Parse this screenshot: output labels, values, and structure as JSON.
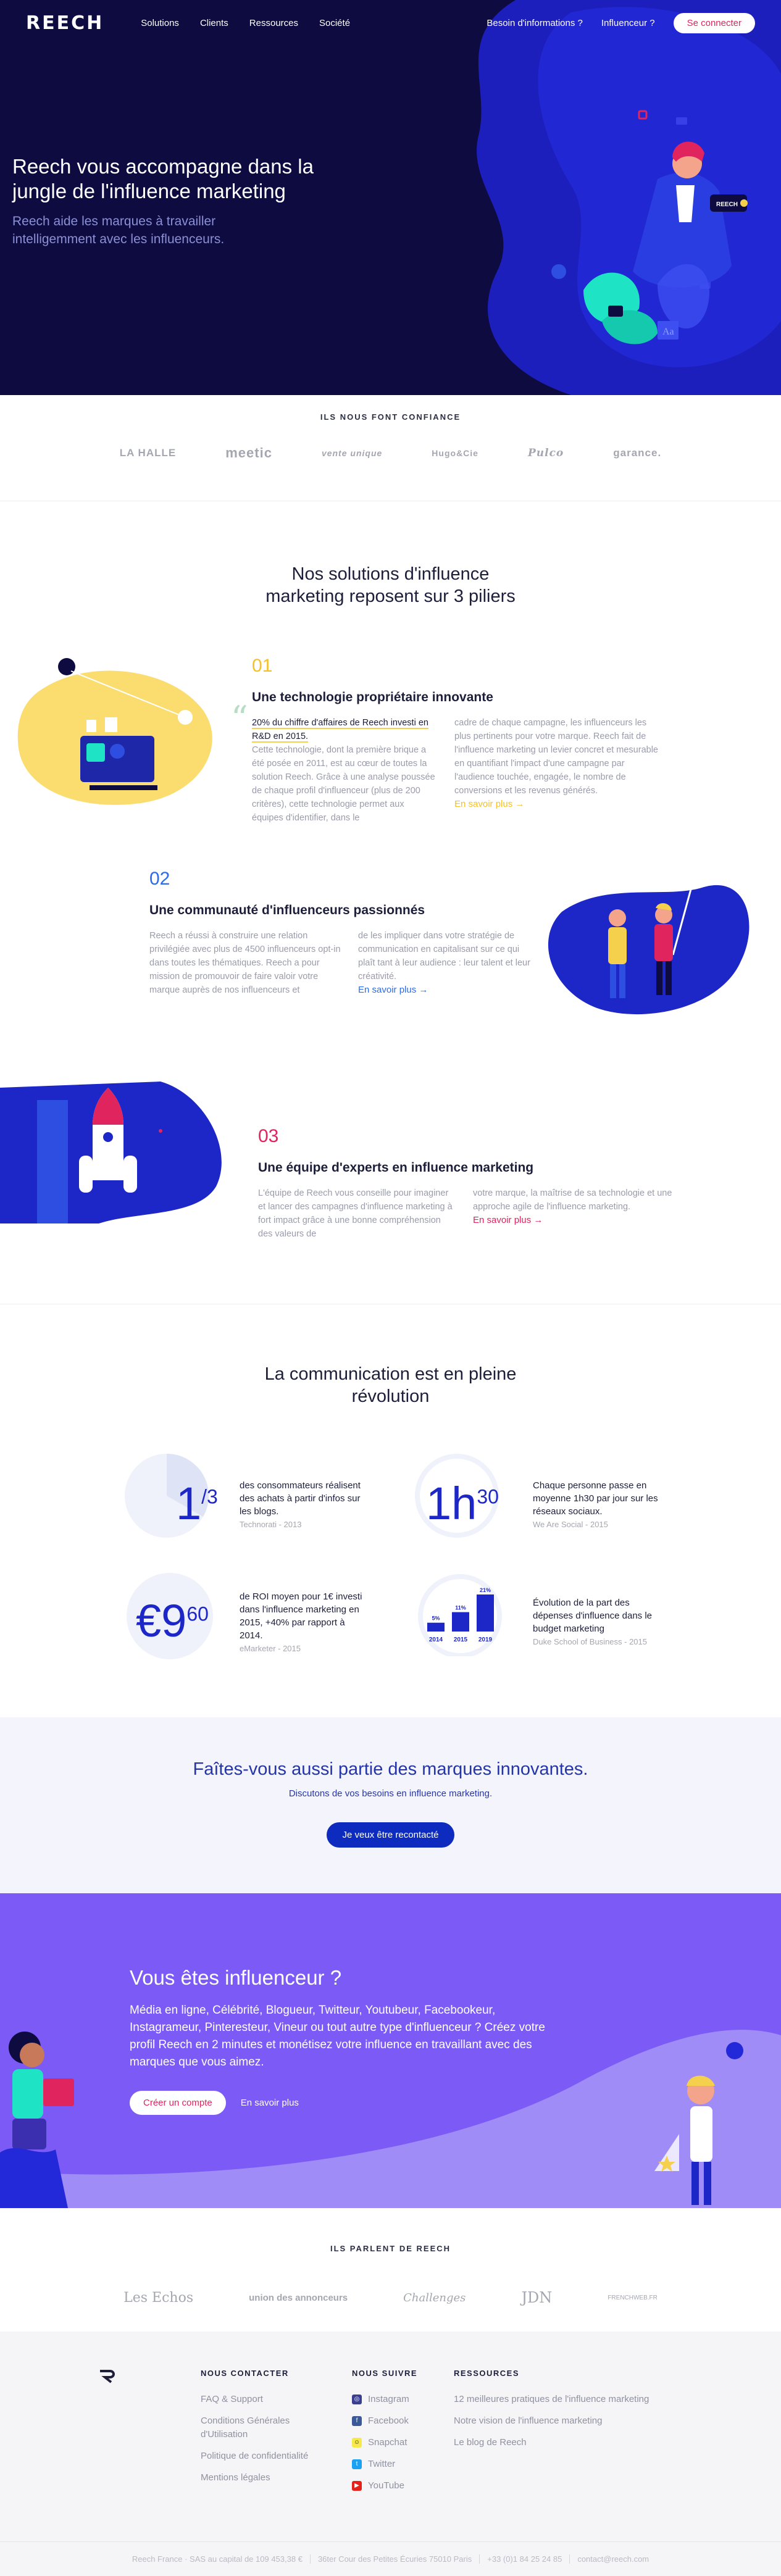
{
  "nav": {
    "logo": "REECH",
    "links": [
      "Solutions",
      "Clients",
      "Ressources",
      "Société"
    ],
    "right_links": [
      "Besoin d'informations ?",
      "Influenceur ?"
    ],
    "login": "Se connecter"
  },
  "hero": {
    "title": "Reech vous accompagne dans la jungle de l'influence marketing",
    "subtitle": "Reech aide les marques à travailler intelligemment avec les influenceurs.",
    "badge": "REECH",
    "aa": "Aa"
  },
  "trust": {
    "title": "ILS NOUS FONT CONFIANCE",
    "logos": [
      "LA HALLE",
      "meetic",
      "vente unique",
      "Hugo&Cie",
      "Pulco",
      "garance."
    ]
  },
  "pillars": {
    "title_line1": "Nos solutions d'influence",
    "title_line2": "marketing reposent sur 3 piliers",
    "items": [
      {
        "num": "01",
        "title": "Une technologie propriétaire innovante",
        "highlight": "20% du chiffre d'affaires de Reech investi en R&D en 2015.",
        "col1": "Cette technologie, dont la première brique a été posée en 2011, est au cœur de toutes la solution Reech. Grâce à une analyse poussée de chaque profil d'influenceur (plus de 200 critères), cette technologie permet aux équipes d'identifier, dans le",
        "col2": "cadre de chaque campagne, les influenceurs les plus pertinents pour votre marque. Reech fait de l'influence marketing un levier concret et mesurable en quantifiant l'impact d'une campagne par l'audience touchée, engagée, le nombre de conversions et les revenus générés.",
        "more": "En savoir plus →"
      },
      {
        "num": "02",
        "title": "Une communauté d'influenceurs passionnés",
        "col1": "Reech a réussi à construire une relation privilégiée avec plus de 4500 influenceurs opt-in dans toutes les thématiques. Reech a pour mission de promouvoir de faire valoir votre marque auprès de nos influenceurs et",
        "col2": "de les impliquer dans votre stratégie de communication en capitalisant sur ce qui plaît tant à leur audience : leur talent et leur créativité.",
        "more": "En savoir plus →"
      },
      {
        "num": "03",
        "title": "Une équipe d'experts en influence marketing",
        "col1": "L'équipe de Reech vous conseille pour imaginer et lancer des campagnes d'influence marketing à fort impact grâce à une bonne compréhension des valeurs de",
        "col2": "votre marque, la maîtrise de sa technologie et une approche agile de l'influence marketing.",
        "more": "En savoir plus →"
      }
    ]
  },
  "revolution": {
    "title_line1": "La communication est en pleine",
    "title_line2": "révolution",
    "stats": [
      {
        "big_main": "1",
        "big_sup": "/3",
        "text": "des consommateurs réalisent des achats à partir d'infos sur les blogs.",
        "source": "Technorati - 2013"
      },
      {
        "big_main": "1h",
        "big_sup": "30",
        "text": "Chaque personne passe en moyenne 1h30 par jour sur les réseaux sociaux.",
        "source": "We Are Social - 2015"
      },
      {
        "big_main": "€9",
        "big_sup": "60",
        "text": "de ROI moyen pour 1€ investi dans l'influence marketing en 2015, +40% par rapport à 2014.",
        "source": "eMarketer - 2015"
      },
      {
        "text": "Évolution de la part des dépenses d'influence dans le budget marketing",
        "source": "Duke School of Business - 2015"
      }
    ],
    "chart_data": {
      "type": "bar",
      "categories": [
        "2014",
        "2015",
        "2019"
      ],
      "values": [
        5,
        11,
        21
      ],
      "labels": [
        "5%",
        "11%",
        "21%"
      ]
    }
  },
  "brands": {
    "title": "Faîtes-vous aussi partie des marques innovantes.",
    "subtitle": "Discutons de vos besoins en influence marketing.",
    "button": "Je veux être recontacté"
  },
  "influencer": {
    "title": "Vous êtes influenceur ?",
    "body": "Média en ligne, Célébrité, Blogueur, Twitteur, Youtubeur, Facebookeur, Instagrameur, Pinteresteur, Vineur ou tout autre type d'influenceur ? Créez votre profil Reech en 2 minutes et monétisez votre influence en travaillant avec des marques que vous aimez.",
    "create_button": "Créer un compte",
    "more_link": "En savoir plus"
  },
  "press": {
    "title": "ILS PARLENT DE REECH",
    "logos": [
      "Les Echos",
      "union des annonceurs",
      "Challenges",
      "JDN",
      "FRENCHWEB.FR"
    ]
  },
  "footer": {
    "contact": {
      "title": "NOUS CONTACTER",
      "items": [
        "FAQ & Support",
        "Conditions Générales d'Utilisation",
        "Politique de confidentialité",
        "Mentions légales"
      ]
    },
    "follow": {
      "title": "NOUS SUIVRE",
      "items": [
        "Instagram",
        "Facebook",
        "Snapchat",
        "Twitter",
        "YouTube"
      ]
    },
    "resources": {
      "title": "RESSOURCES",
      "items": [
        "12 meilleures pratiques de l'influence marketing",
        "Notre vision de l'influence marketing",
        "Le blog de Reech"
      ]
    },
    "bottom": [
      "Reech France · SAS au capital de 109 453,38 €",
      "36ter Cour des Petites Écuries 75010 Paris",
      "+33 (0)1 84 25 24 85",
      "contact@reech.com"
    ],
    "colors": {
      "instagram": "#3b3f8f",
      "facebook": "#3b5998",
      "snapchat": "#f7e94d",
      "twitter": "#1da1f2",
      "youtube": "#e62117"
    }
  }
}
